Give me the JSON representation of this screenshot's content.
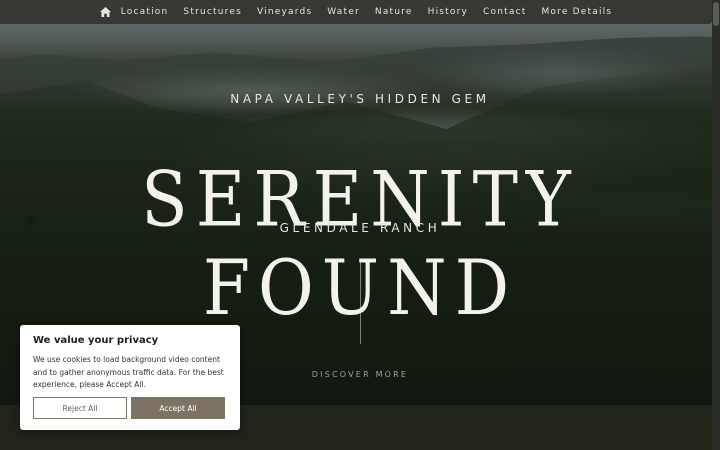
{
  "nav": {
    "icon": "home-icon",
    "items": [
      {
        "label": "Location"
      },
      {
        "label": "Structures"
      },
      {
        "label": "Vineyards"
      },
      {
        "label": "Water"
      },
      {
        "label": "Nature"
      },
      {
        "label": "History"
      },
      {
        "label": "Contact"
      },
      {
        "label": "More Details"
      }
    ]
  },
  "hero": {
    "kicker": "NAPA VALLEY'S HIDDEN GEM",
    "title": "SERENITY FOUND",
    "subtitle": "GLENDALE RANCH",
    "discover": "DISCOVER MORE"
  },
  "cookie": {
    "title": "We value your privacy",
    "body": "We use cookies to load background video content and to gather anonymous traffic data. For the best experience, please Accept All.",
    "reject_label": "Reject All",
    "accept_label": "Accept All"
  },
  "colors": {
    "nav_bg": "#323430",
    "accent": "#7d7365",
    "text_light": "#f4f2ec"
  }
}
